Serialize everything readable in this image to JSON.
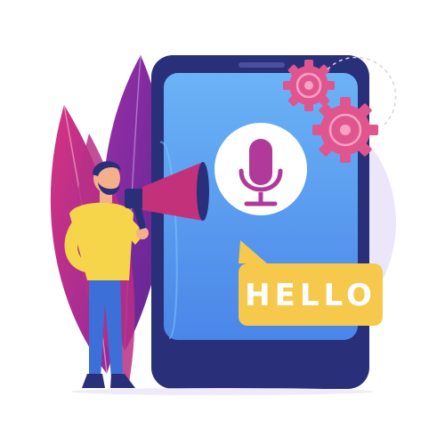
{
  "speech_bubble": {
    "text": "HELLO"
  },
  "icons": [
    "microphone-icon",
    "gear-icon",
    "megaphone-icon"
  ],
  "colors": {
    "tablet_frame": "#2a2f7a",
    "tablet_screen": "#5aa0f2",
    "gear": "#e0558d",
    "leaf_magenta": "#c2317a",
    "leaf_purple": "#7a2a9a",
    "bubble": "#f6c84c",
    "shirt": "#f7d54a",
    "pants": "#3d6fd8",
    "microphone": "#b0399a"
  }
}
